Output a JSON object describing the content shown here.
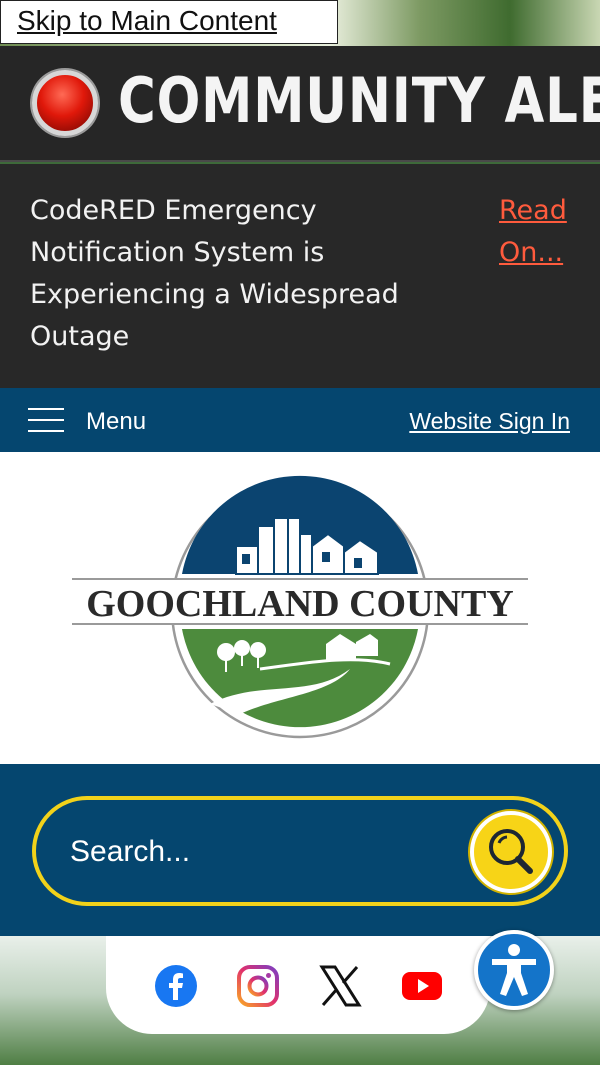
{
  "skip_link": "Skip to Main Content",
  "alert": {
    "title": "COMMUNITY ALERT",
    "message": "CodeRED Emergency Notification System is Experiencing a Widespread Outage",
    "read_more": "Read On..."
  },
  "nav": {
    "menu_label": "Menu",
    "sign_in": "Website Sign In"
  },
  "logo": {
    "text": "GOOCHLAND COUNTY"
  },
  "search": {
    "placeholder": "Search..."
  },
  "social": [
    {
      "name": "facebook-icon"
    },
    {
      "name": "instagram-icon"
    },
    {
      "name": "x-icon"
    },
    {
      "name": "youtube-icon"
    }
  ],
  "colors": {
    "nav_blue": "#05466f",
    "alert_dark": "#262626",
    "read_more_red": "#ff5b3d",
    "search_yellow": "#f7d417",
    "logo_blue": "#0b4470",
    "logo_green": "#4d8b3d"
  }
}
